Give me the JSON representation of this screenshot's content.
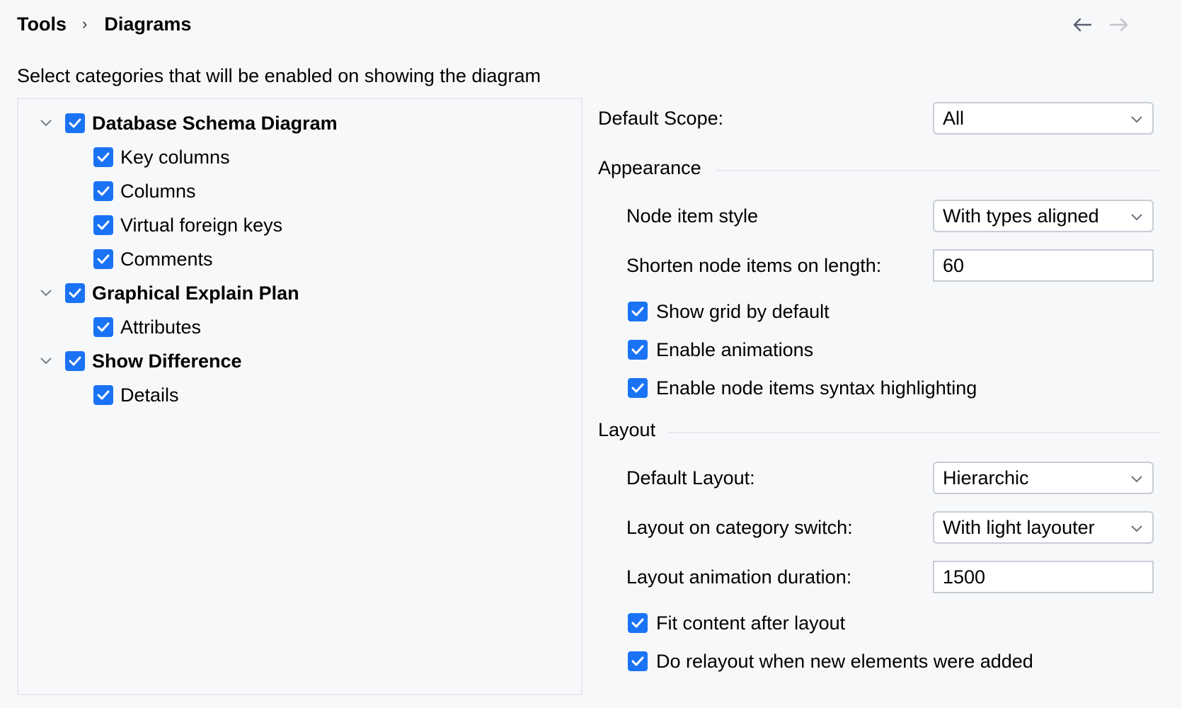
{
  "breadcrumb": {
    "parent": "Tools",
    "separator": "›",
    "current": "Diagrams"
  },
  "nav": {
    "back_icon": "arrow-left-icon",
    "forward_icon": "arrow-right-icon",
    "back_enabled": true,
    "forward_enabled": false
  },
  "description": "Select categories that will be enabled on showing the diagram",
  "tree": {
    "groups": [
      {
        "label": "Database Schema Diagram",
        "checked": true,
        "expanded": true,
        "children": [
          {
            "label": "Key columns",
            "checked": true
          },
          {
            "label": "Columns",
            "checked": true
          },
          {
            "label": "Virtual foreign keys",
            "checked": true
          },
          {
            "label": "Comments",
            "checked": true
          }
        ]
      },
      {
        "label": "Graphical Explain Plan",
        "checked": true,
        "expanded": true,
        "children": [
          {
            "label": "Attributes",
            "checked": true
          }
        ]
      },
      {
        "label": "Show Difference",
        "checked": true,
        "expanded": true,
        "children": [
          {
            "label": "Details",
            "checked": true
          }
        ]
      }
    ]
  },
  "settings": {
    "default_scope": {
      "label": "Default Scope:",
      "value": "All"
    },
    "appearance": {
      "title": "Appearance",
      "node_item_style": {
        "label": "Node item style",
        "value": "With types aligned"
      },
      "shorten_length": {
        "label": "Shorten node items on length:",
        "value": "60"
      },
      "show_grid": {
        "label": "Show grid by default",
        "checked": true
      },
      "enable_animations": {
        "label": "Enable animations",
        "checked": true
      },
      "syntax_highlighting": {
        "label": "Enable node items syntax highlighting",
        "checked": true
      }
    },
    "layout": {
      "title": "Layout",
      "default_layout": {
        "label": "Default Layout:",
        "value": "Hierarchic"
      },
      "category_switch": {
        "label": "Layout on category switch:",
        "value": "With light layouter"
      },
      "animation_duration": {
        "label": "Layout animation duration:",
        "value": "1500"
      },
      "fit_content": {
        "label": "Fit content after layout",
        "checked": true
      },
      "relayout": {
        "label": "Do relayout when new elements were added",
        "checked": true
      }
    }
  },
  "colors": {
    "accent": "#1a73f5",
    "background": "#f7f8fa",
    "border": "#c9ccd6"
  }
}
